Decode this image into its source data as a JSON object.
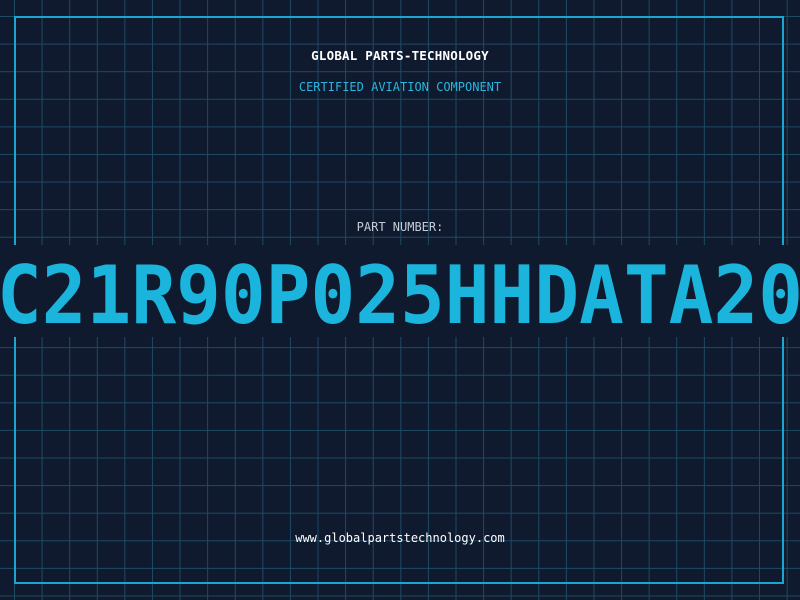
{
  "label": {
    "company": "GLOBAL PARTS-TECHNOLOGY",
    "subtitle": "CERTIFIED AVIATION COMPONENT",
    "part_number_label": "PART NUMBER:",
    "part_number": "C21R90P025HHDATA20",
    "website": "www.globalpartstechnology.com"
  },
  "colors": {
    "background": "#0f1a2e",
    "grid": "#1e4a64",
    "accent": "#1aa6cf",
    "part_number": "#1ab4dc"
  }
}
